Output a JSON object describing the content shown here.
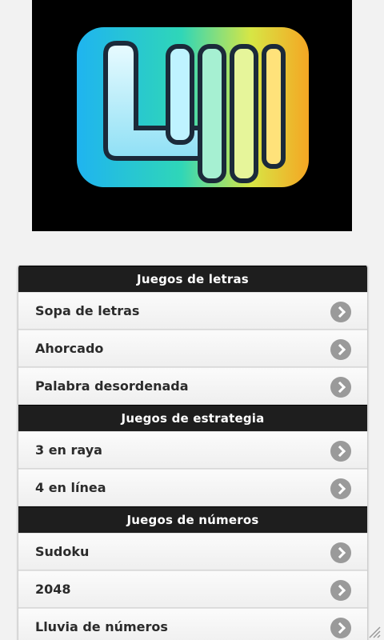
{
  "logo": {
    "icon": "letters-games-app-logo"
  },
  "sections": [
    {
      "title": "Juegos de letras",
      "items": [
        "Sopa de letras",
        "Ahorcado",
        "Palabra desordenada"
      ]
    },
    {
      "title": "Juegos de estrategia",
      "items": [
        "3 en raya",
        "4 en línea"
      ]
    },
    {
      "title": "Juegos de números",
      "items": [
        "Sudoku",
        "2048",
        "Lluvia de números"
      ]
    }
  ],
  "colors": {
    "header_bg": "#1e1e1e",
    "item_text": "#2b2b2b",
    "chevron": "#9a9a9a"
  }
}
